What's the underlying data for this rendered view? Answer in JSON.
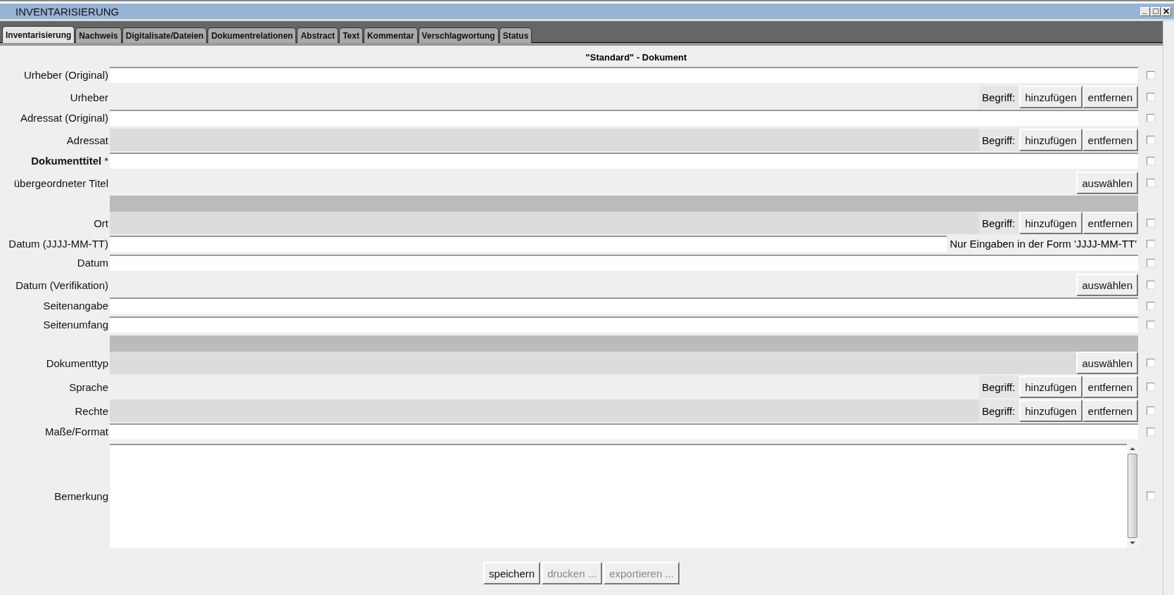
{
  "window": {
    "title": "INVENTARISIERUNG"
  },
  "tabs": [
    {
      "label": "Inventarisierung",
      "selected": true
    },
    {
      "label": "Nachweis",
      "selected": false
    },
    {
      "label": "Digitalisate/Dateien",
      "selected": false
    },
    {
      "label": "Dokumentrelationen",
      "selected": false
    },
    {
      "label": "Abstract",
      "selected": false
    },
    {
      "label": "Text",
      "selected": false
    },
    {
      "label": "Kommentar",
      "selected": false
    },
    {
      "label": "Verschlagwortung",
      "selected": false
    },
    {
      "label": "Status",
      "selected": false
    }
  ],
  "heading": "\"Standard\" - Dokument",
  "rows": [
    {
      "kind": "text",
      "label": "Urheber (Original)",
      "checked": false
    },
    {
      "kind": "term",
      "label": "Urheber",
      "shaded": false,
      "term_label": "Begriff:",
      "add": "hinzufügen",
      "remove": "entfernen",
      "checked": false
    },
    {
      "kind": "text",
      "label": "Adressat (Original)",
      "checked": false
    },
    {
      "kind": "term",
      "label": "Adressat",
      "shaded": true,
      "term_label": "Begriff:",
      "add": "hinzufügen",
      "remove": "entfernen",
      "checked": false
    },
    {
      "kind": "text",
      "label": "Dokumenttitel",
      "required": true,
      "mark": "*",
      "checked": false
    },
    {
      "kind": "select",
      "label": "übergeordneter Titel",
      "shaded": false,
      "button": "auswählen",
      "checked": false
    },
    {
      "kind": "separator"
    },
    {
      "kind": "term",
      "label": "Ort",
      "shaded": true,
      "term_label": "Begriff:",
      "add": "hinzufügen",
      "remove": "entfernen",
      "checked": false
    },
    {
      "kind": "date",
      "label": "Datum (JJJJ-MM-TT)",
      "hint": "Nur Eingaben in der Form 'JJJJ-MM-TT'",
      "checked": false
    },
    {
      "kind": "text",
      "label": "Datum",
      "checked": false
    },
    {
      "kind": "select",
      "label": "Datum (Verifikation)",
      "shaded": false,
      "button": "auswählen",
      "checked": false
    },
    {
      "kind": "text",
      "label": "Seitenangabe",
      "checked": false
    },
    {
      "kind": "text",
      "label": "Seitenumfang",
      "checked": false
    },
    {
      "kind": "separator"
    },
    {
      "kind": "select",
      "label": "Dokumenttyp",
      "shaded": true,
      "button": "auswählen",
      "checked": false
    },
    {
      "kind": "term",
      "label": "Sprache",
      "shaded": false,
      "term_label": "Begriff:",
      "add": "hinzufügen",
      "remove": "entfernen",
      "checked": false
    },
    {
      "kind": "term",
      "label": "Rechte",
      "shaded": true,
      "term_label": "Begriff:",
      "add": "hinzufügen",
      "remove": "entfernen",
      "checked": false
    },
    {
      "kind": "text",
      "label": "Maße/Format",
      "checked": false
    },
    {
      "kind": "textarea",
      "label": "Bemerkung",
      "checked": false
    }
  ],
  "buttons": [
    {
      "label": "speichern",
      "disabled": false
    },
    {
      "label": "drucken ...",
      "disabled": true
    },
    {
      "label": "exportieren ...",
      "disabled": true
    }
  ]
}
